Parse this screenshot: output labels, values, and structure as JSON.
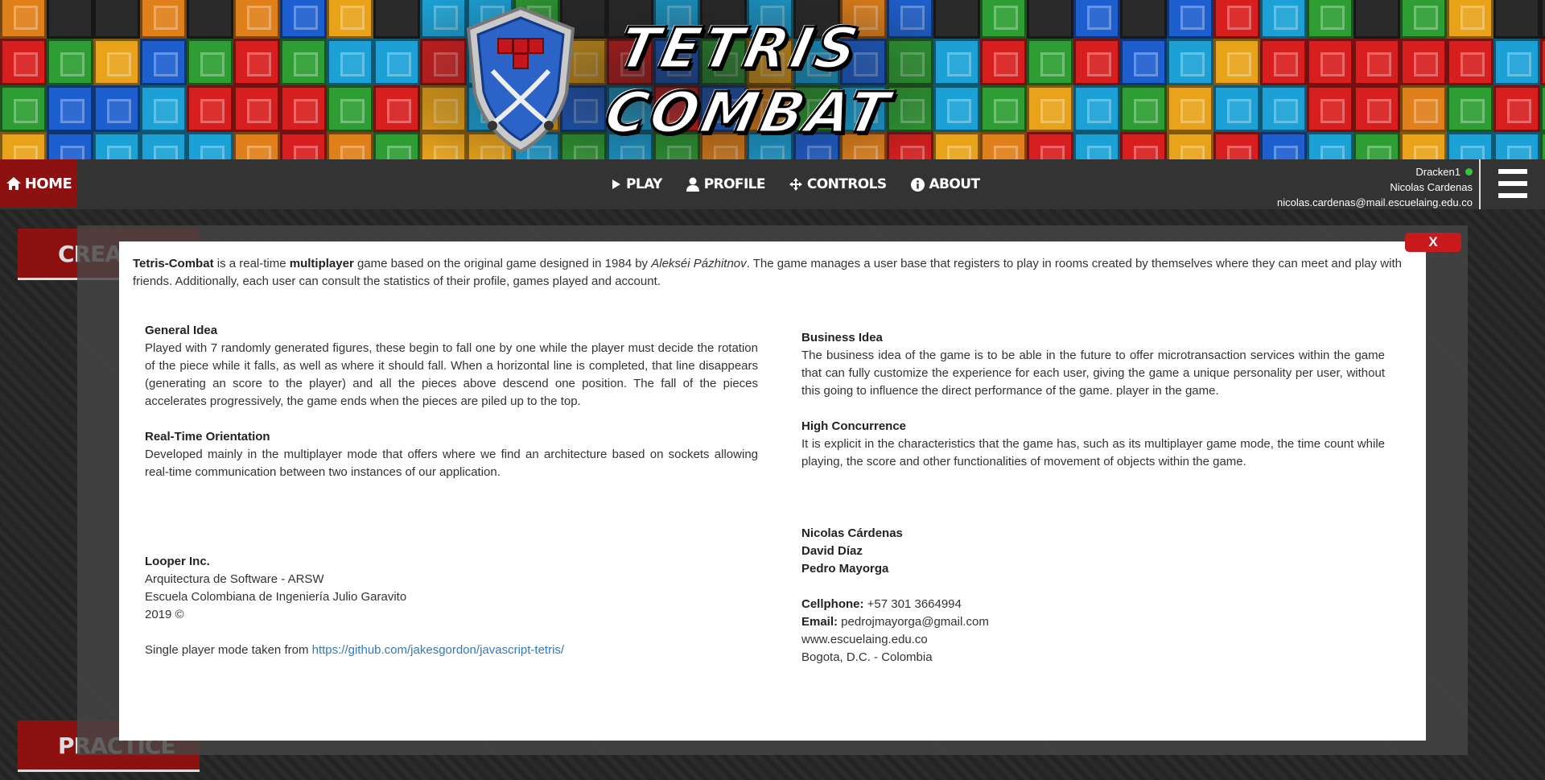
{
  "logo": {
    "line1": "TETRIS",
    "line2": "COMBAT"
  },
  "nav": {
    "home": "HOME",
    "items": [
      {
        "label": "PLAY",
        "icon": "play-icon"
      },
      {
        "label": "PROFILE",
        "icon": "user-icon"
      },
      {
        "label": "CONTROLS",
        "icon": "arrows-icon"
      },
      {
        "label": "ABOUT",
        "icon": "info-icon"
      }
    ]
  },
  "user": {
    "nickname": "Dracken1",
    "name": "Nicolas Cardenas",
    "email": "nicolas.cardenas@mail.escuelaing.edu.co",
    "status_color": "#37c43c"
  },
  "background": {
    "tab1": "CREATE",
    "tab2": "PRACTICE"
  },
  "modal": {
    "close": "X",
    "intro": {
      "brand": "Tetris-Combat",
      "t1": " is a real-time ",
      "multiplayer": "multiplayer",
      "t2": " game based on the original game designed in 1984 by ",
      "author": "Alekséi Pázhitnov",
      "t3": ". The game manages a user base that registers to play in rooms created by themselves where they can meet and play with friends. Additionally, each user can consult the statistics of their profile, games played and account."
    },
    "general_idea": {
      "title": "General Idea",
      "text": "Played with 7 randomly generated figures, these begin to fall one by one while the player must decide the rotation of the piece while it falls, as well as where it should fall. When a horizontal line is completed, that line disappears (generating an score to the player) and all the pieces above descend one position. The fall of the pieces accelerates progressively, the game ends when the pieces are piled up to the top."
    },
    "realtime": {
      "title": "Real-Time Orientation",
      "text": "Developed mainly in the multiplayer mode that offers where we find an architecture based on sockets allowing real-time communication between two instances of our application."
    },
    "business": {
      "title": "Business Idea",
      "text": "The business idea of the game is to be able in the future to offer microtransaction services within the game that can fully customize the experience for each user, giving the game a unique personality per user, without this going to influence the direct performance of the game. player in the game."
    },
    "concurrence": {
      "title": "High Concurrence",
      "text": "It is explicit in the characteristics that the game has, such as its multiplayer game mode, the time count while playing, the score and other functionalities of movement of objects within the game."
    },
    "company": {
      "name": "Looper Inc.",
      "course": "Arquitectura de Software - ARSW",
      "school": "Escuela Colombiana de Ingeniería Julio Garavito",
      "year": "2019 ©",
      "single_text": "Single player mode taken from ",
      "link": "https://github.com/jakesgordon/javascript-tetris/"
    },
    "authors": [
      "Nicolas Cárdenas",
      "David Díaz",
      "Pedro Mayorga"
    ],
    "contact": {
      "cell_label": "Cellphone:",
      "cell": " +57 301 3664994",
      "email_label": "Email:",
      "email": " pedrojmayorga@gmail.com",
      "web": "www.escuelaing.edu.co",
      "city": "Bogota, D.C. - Colombia"
    }
  }
}
